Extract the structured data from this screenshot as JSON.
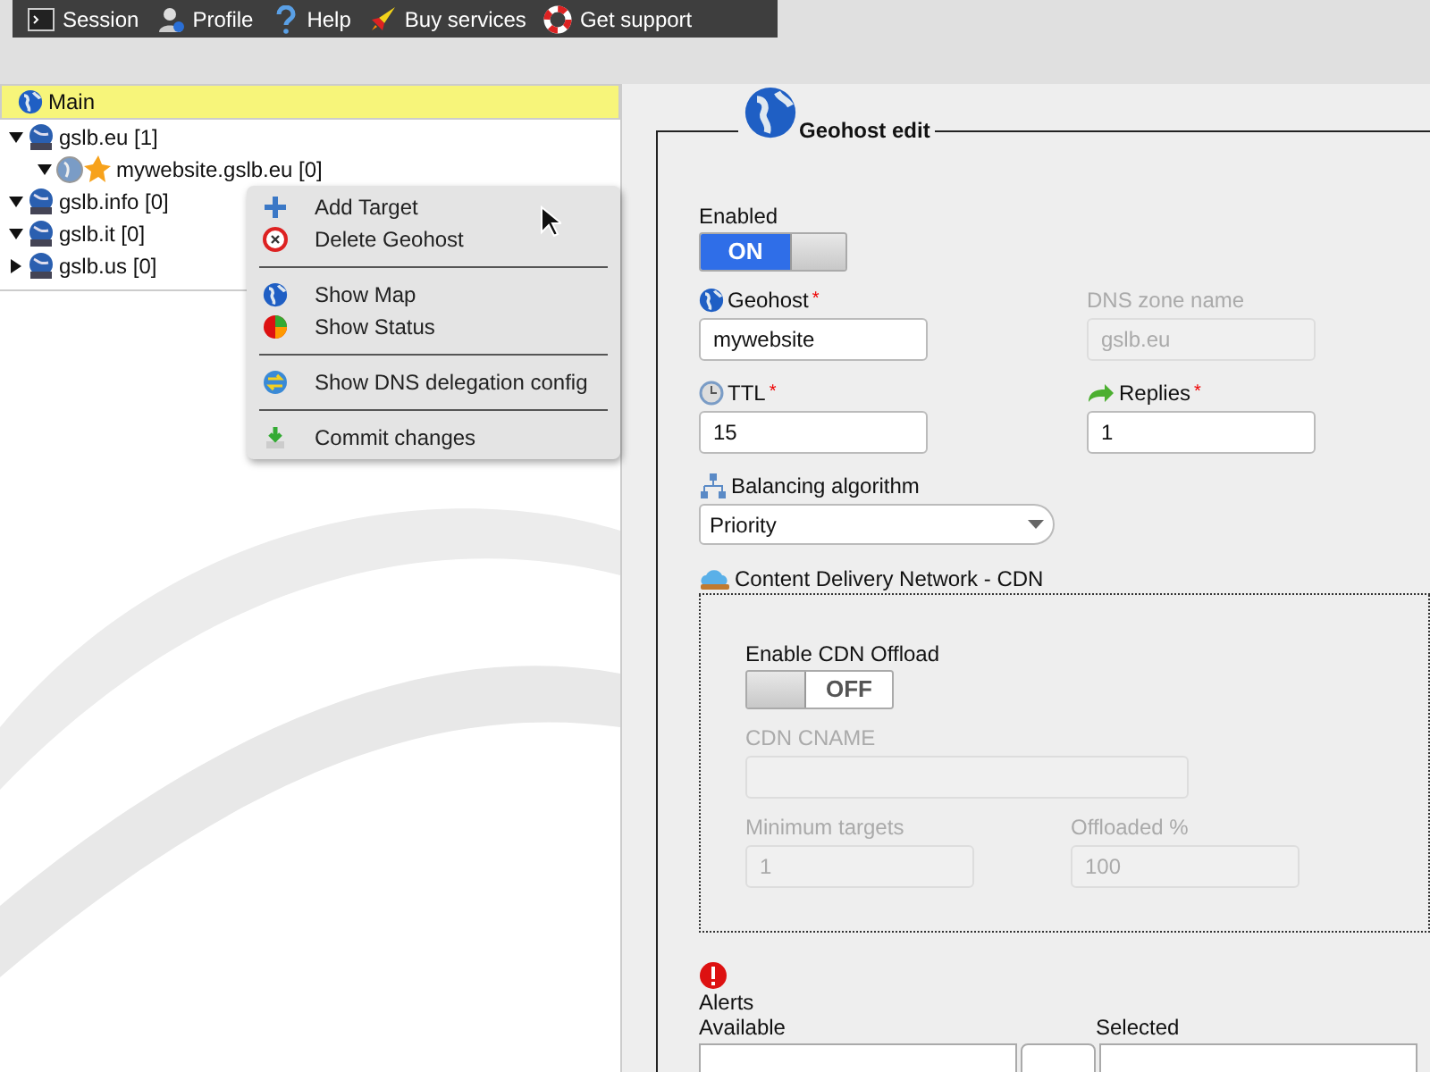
{
  "toolbar": [
    {
      "label": "Session",
      "kind": "terminal"
    },
    {
      "label": "Profile",
      "kind": "user"
    },
    {
      "label": "Help",
      "kind": "help"
    },
    {
      "label": "Buy services",
      "kind": "rocket"
    },
    {
      "label": "Get support",
      "kind": "lifebuoy"
    }
  ],
  "tree": {
    "title": "Main",
    "items": [
      {
        "label": "gslb.eu [1]",
        "kind": "zone",
        "expanded": true,
        "children": [
          {
            "label": "mywebsite.gslb.eu [0]",
            "kind": "geohost",
            "expanded": true
          }
        ]
      },
      {
        "label": "gslb.info [0]",
        "kind": "zone",
        "expanded": true
      },
      {
        "label": "gslb.it [0]",
        "kind": "zone",
        "expanded": true
      },
      {
        "label": "gslb.us [0]",
        "kind": "zone",
        "expanded": false
      }
    ]
  },
  "context_menu": [
    [
      {
        "label": "Add Target",
        "kind": "plus"
      },
      {
        "label": "Delete Geohost",
        "kind": "delete"
      }
    ],
    [
      {
        "label": "Show Map",
        "kind": "globe"
      },
      {
        "label": "Show Status",
        "kind": "pie"
      }
    ],
    [
      {
        "label": "Show DNS delegation config",
        "kind": "dns"
      }
    ],
    [
      {
        "label": "Commit changes",
        "kind": "commit"
      }
    ]
  ],
  "form": {
    "title": "Geohost edit",
    "enabled": {
      "label": "Enabled",
      "on": true,
      "state_text": "ON"
    },
    "geohost": {
      "label": "Geohost",
      "required_mark": "*",
      "value": "mywebsite"
    },
    "dns_zone": {
      "label": "DNS zone name",
      "value": "gslb.eu",
      "disabled": true
    },
    "ttl": {
      "label": "TTL",
      "required_mark": "*",
      "value": "15"
    },
    "replies": {
      "label": "Replies",
      "required_mark": "*",
      "value": "1"
    },
    "balancing": {
      "label": "Balancing algorithm",
      "value": "Priority"
    },
    "cdn": {
      "title": "Content Delivery Network - CDN",
      "offload": {
        "label": "Enable CDN Offload",
        "on": false,
        "state_text": "OFF"
      },
      "cname": {
        "label": "CDN CNAME",
        "disabled": true
      },
      "min_targets": {
        "label": "Minimum targets",
        "value": "1",
        "disabled": true
      },
      "offloaded": {
        "label": "Offloaded %",
        "value": "100",
        "disabled": true
      }
    },
    "alerts": {
      "label": "Alerts",
      "available_label": "Available",
      "selected_label": "Selected"
    }
  }
}
